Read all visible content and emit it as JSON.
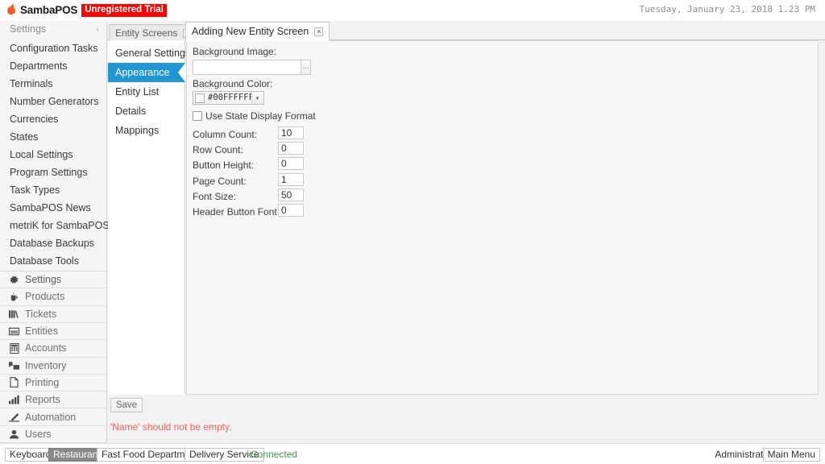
{
  "titlebar": {
    "brand_name": "SambaPOS",
    "trial_badge": "Unregistered Trial",
    "clock": "Tuesday, January 23, 2018 1.23 PM"
  },
  "sidebar": {
    "header": "Settings",
    "collapse_glyph": "‹",
    "items": [
      {
        "label": "Configuration Tasks"
      },
      {
        "label": "Departments"
      },
      {
        "label": "Terminals"
      },
      {
        "label": "Number Generators"
      },
      {
        "label": "Currencies"
      },
      {
        "label": "States"
      },
      {
        "label": "Local Settings"
      },
      {
        "label": "Program Settings"
      },
      {
        "label": "Task Types"
      },
      {
        "label": "SambaPOS News"
      },
      {
        "label": "metriK for SambaPOS"
      },
      {
        "label": "Database Backups"
      },
      {
        "label": "Database Tools"
      }
    ],
    "modules": [
      {
        "label": "Settings",
        "icon": "gear-icon"
      },
      {
        "label": "Products",
        "icon": "cup-icon"
      },
      {
        "label": "Tickets",
        "icon": "tickets-icon"
      },
      {
        "label": "Entities",
        "icon": "entities-icon"
      },
      {
        "label": "Accounts",
        "icon": "calculator-icon"
      },
      {
        "label": "Inventory",
        "icon": "boxes-icon"
      },
      {
        "label": "Printing",
        "icon": "page-icon"
      },
      {
        "label": "Reports",
        "icon": "barchart-icon"
      },
      {
        "label": "Automation",
        "icon": "pencil-icon"
      },
      {
        "label": "Users",
        "icon": "user-icon"
      }
    ]
  },
  "tabs": [
    {
      "label": "Entity Screens",
      "close_glyph": "×",
      "active": false
    },
    {
      "label": "Adding New Entity Screen",
      "close_glyph": "×",
      "active": true
    }
  ],
  "subnav": {
    "items": [
      {
        "label": "General Settings",
        "selected": false
      },
      {
        "label": "Appearance",
        "selected": true
      },
      {
        "label": "Entity List",
        "selected": false
      },
      {
        "label": "Details",
        "selected": false
      },
      {
        "label": "Mappings",
        "selected": false
      }
    ]
  },
  "form": {
    "background_image": {
      "label": "Background Image:",
      "value": "",
      "placeholder": "",
      "browse_label": "..."
    },
    "background_color": {
      "label": "Background Color:",
      "value": "#00FFFFFF",
      "swatch": "#FFFFFF",
      "arrow_glyph": "▾"
    },
    "use_state_display_format": {
      "label": "Use State Display Format",
      "checked": false
    },
    "numeric_fields": [
      {
        "label": "Column Count:",
        "value": "10"
      },
      {
        "label": "Row Count:",
        "value": "0"
      },
      {
        "label": "Button Height:",
        "value": "0"
      },
      {
        "label": "Page Count:",
        "value": "1"
      },
      {
        "label": "Font Size:",
        "value": "50"
      },
      {
        "label": "Header Button Font Size:",
        "value": "0"
      }
    ],
    "save_label": "Save",
    "error_message": "'Name' should not be empty."
  },
  "statusbar": {
    "keyboard_label": "Keyboard",
    "restaurant_label": "Restaurant",
    "department_label": "Fast Food Department",
    "delivery_label": "Delivery Service",
    "connection_status": "Connected",
    "connection_color": "#3f9a4a",
    "user_label": "Administrator",
    "main_menu_label": "Main Menu"
  },
  "colors": {
    "accent": "#2196d3",
    "trial_red": "#fe0000",
    "error_red": "#f4605a",
    "brand_orange": "#f15a22"
  }
}
